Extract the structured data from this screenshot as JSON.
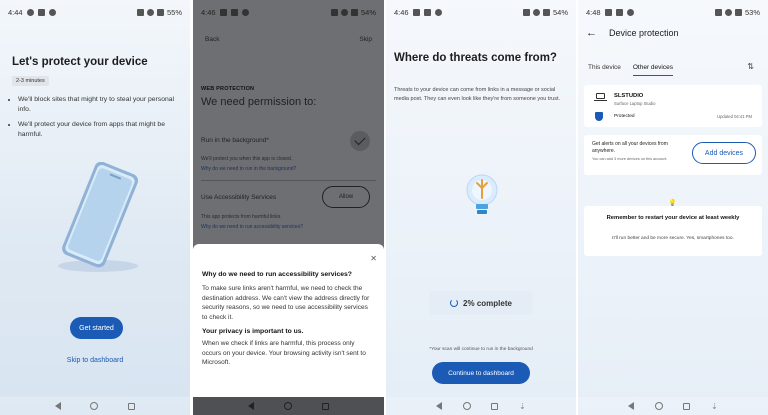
{
  "screen1": {
    "status_time": "4:44",
    "status_battery": "55%",
    "title": "Let's protect your device",
    "duration_badge": "2-3 minutes",
    "bullets": [
      "We'll block sites that might try to steal your personal info.",
      "We'll protect your device from apps that might be harmful."
    ],
    "primary_button": "Get started",
    "skip_link": "Skip to dashboard"
  },
  "screen2": {
    "status_time": "4:46",
    "status_battery": "54%",
    "back_label": "Back",
    "skip_label": "Skip",
    "kicker": "WEB PROTECTION",
    "heading": "We need permission to:",
    "item1_title": "Run in the background*",
    "item1_desc": "We'll protect you when this app is closed.",
    "item1_link": "Why do we need to run in the background?",
    "item2_title": "Use Accessibility Services",
    "item2_button": "Allow",
    "item2_desc": "This app protects from harmful links.",
    "item2_link": "Why do we need to run accessibility services?",
    "sheet_title": "Why do we need to run accessibility services?",
    "sheet_para1": "To make sure links aren't harmful, we need to check the destination address. We can't view the address directly for security reasons, so we need to use accessibility services to check it.",
    "sheet_subtitle": "Your privacy is important to us.",
    "sheet_para2": "When we check if links are harmful, this process only occurs on your device. Your browsing activity isn't sent to Microsoft."
  },
  "screen3": {
    "status_time": "4:46",
    "status_battery": "54%",
    "heading": "Where do threats come from?",
    "desc": "Threats to your device can come from links in a message or social media post. They can even look like they're from someone you trust.",
    "progress_text": "2% complete",
    "progress_value": 0.02,
    "note": "*Your scan will continue to run in the background",
    "primary_button": "Continue to dashboard"
  },
  "screen4": {
    "status_time": "4:48",
    "status_battery": "53%",
    "title": "Device protection",
    "tab_this": "This device",
    "tab_other": "Other devices",
    "device_name": "SLSTUDIO",
    "device_model": "Surface Laptop Studio",
    "device_status": "Protected",
    "device_updated": "Updated 04:41 PM",
    "alert_title": "Get alerts on all your devices from anywhere.",
    "alert_sub": "You can add 3 more devices on this account.",
    "add_button": "Add devices",
    "tip_title": "Remember to restart your device at least weekly",
    "tip_sub": "It'll run better and be more secure. Yes, smartphones too."
  },
  "colors": {
    "accent": "#1b5bb6",
    "dim_overlay": "#6d6f73"
  }
}
